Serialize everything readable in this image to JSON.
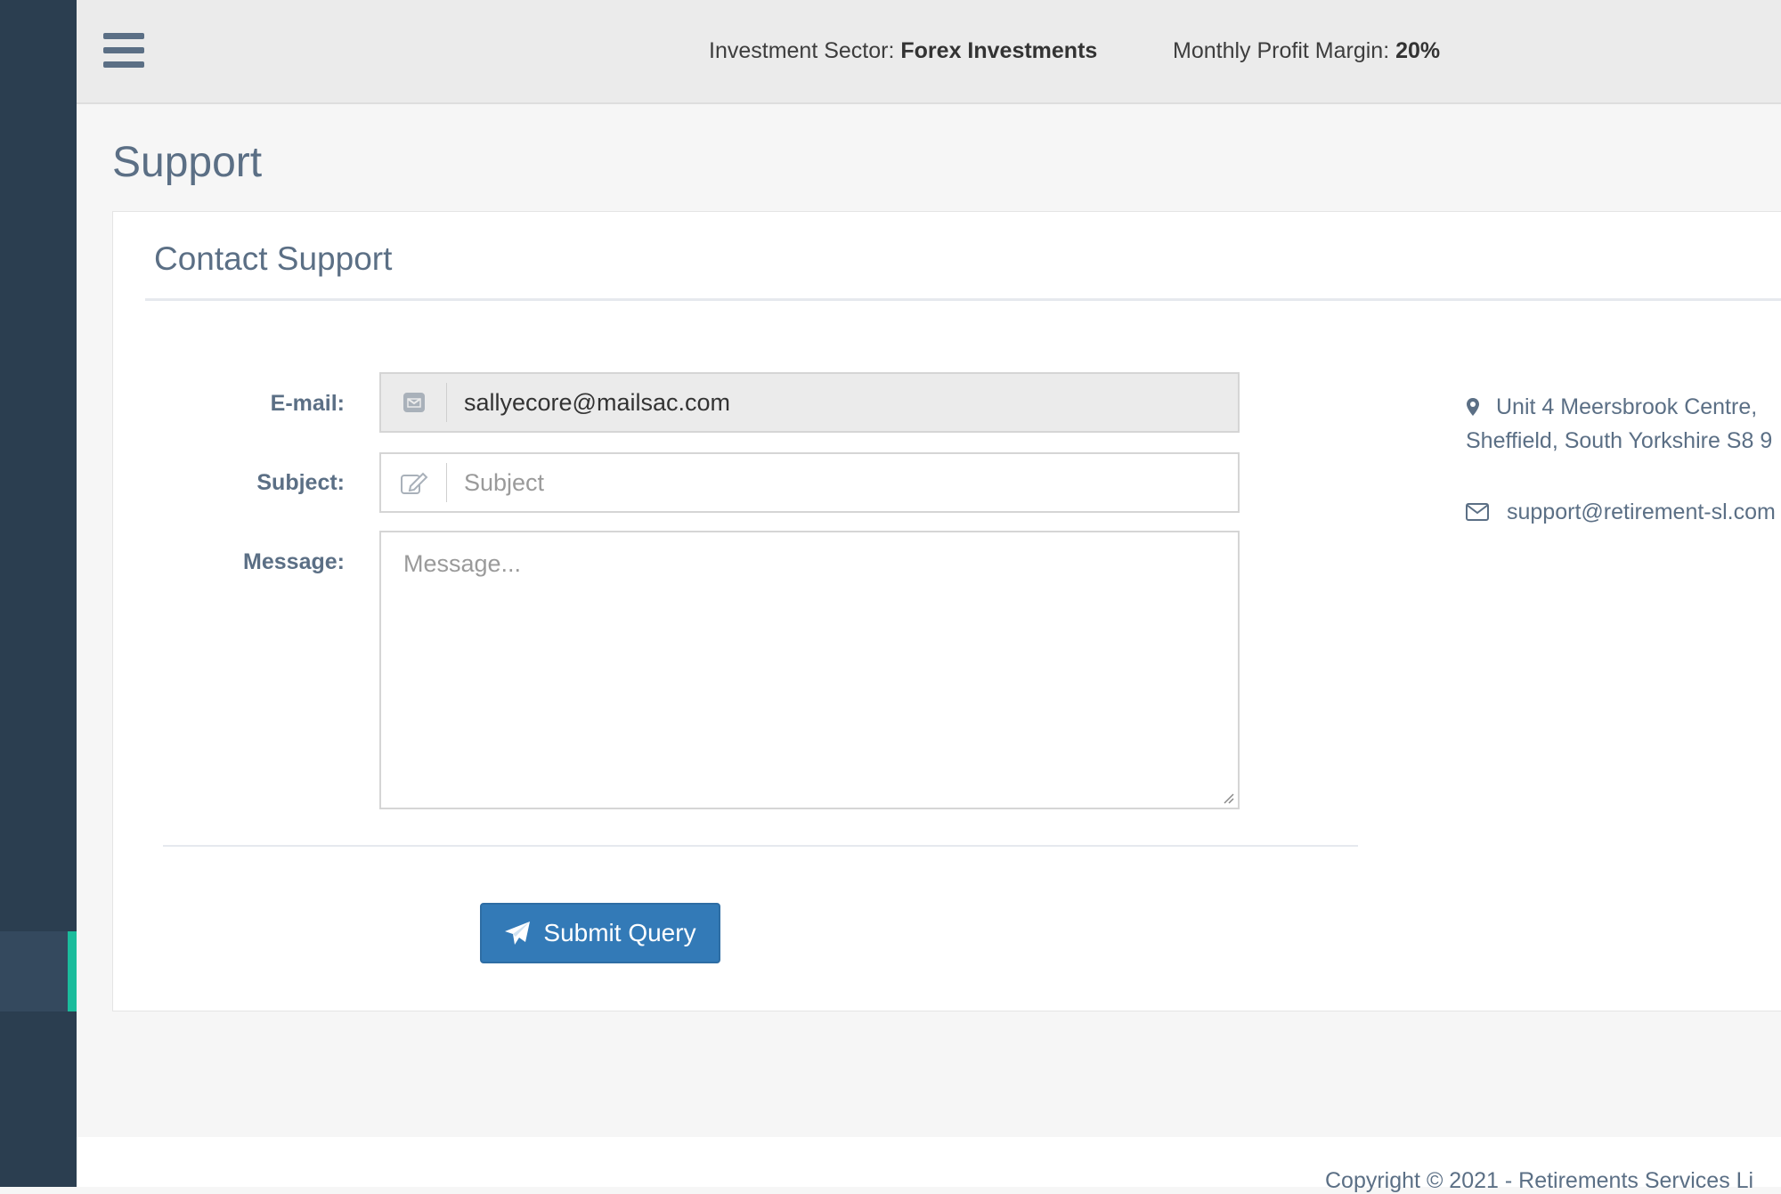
{
  "topbar": {
    "sector_label": "Investment Sector:",
    "sector_value": "Forex Investments",
    "margin_label": "Monthly Profit Margin:",
    "margin_value": "20%"
  },
  "page": {
    "title": "Support"
  },
  "panel": {
    "title": "Contact Support"
  },
  "form": {
    "email_label": "E-mail:",
    "email_value": "sallyecore@mailsac.com",
    "subject_label": "Subject:",
    "subject_placeholder": "Subject",
    "message_label": "Message:",
    "message_placeholder": "Message...",
    "submit_label": "Submit Query"
  },
  "contact": {
    "address_line1": "Unit 4 Meersbrook Centre,",
    "address_line2": "Sheffield, South Yorkshire S8 9",
    "email": "support@retirement-sl.com"
  },
  "footer": {
    "copyright": "Copyright © 2021 - Retirements Services Li"
  },
  "colors": {
    "sidebar": "#2b3e50",
    "accent": "#1abc9c",
    "primary": "#337ab7",
    "heading": "#5b6f85"
  },
  "icons": {
    "menu": "hamburger-menu-icon",
    "email": "envelope-icon",
    "subject": "edit-icon",
    "submit": "paper-plane-icon",
    "address": "map-marker-icon",
    "contact_email": "envelope-outline-icon"
  }
}
